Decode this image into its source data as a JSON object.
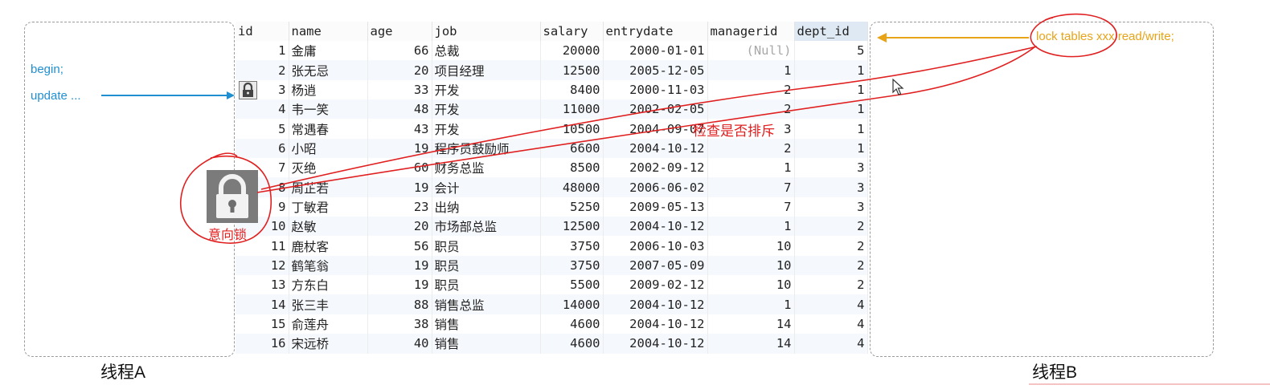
{
  "thread_a": {
    "label": "线程A",
    "lines": [
      "begin;",
      "update ..."
    ]
  },
  "thread_b": {
    "label": "线程B",
    "command": "lock tables xxx read/write;"
  },
  "annotations": {
    "intent_lock": "意向锁",
    "check": "检查是否排斥"
  },
  "colors": {
    "annotation_red": "#e02020",
    "arrow_blue": "#1f8fd1",
    "arrow_orange": "#e8a317"
  },
  "table": {
    "columns": [
      "id",
      "name",
      "age",
      "job",
      "salary",
      "entrydate",
      "managerid",
      "dept_id"
    ],
    "rows": [
      [
        "1",
        "金庸",
        "66",
        "总裁",
        "20000",
        "2000-01-01",
        "(Null)",
        "5"
      ],
      [
        "2",
        "张无忌",
        "20",
        "项目经理",
        "12500",
        "2005-12-05",
        "1",
        "1"
      ],
      [
        "3",
        "杨逍",
        "33",
        "开发",
        "8400",
        "2000-11-03",
        "2",
        "1"
      ],
      [
        "4",
        "韦一笑",
        "48",
        "开发",
        "11000",
        "2002-02-05",
        "2",
        "1"
      ],
      [
        "5",
        "常遇春",
        "43",
        "开发",
        "10500",
        "2004-09-07",
        "3",
        "1"
      ],
      [
        "6",
        "小昭",
        "19",
        "程序员鼓励师",
        "6600",
        "2004-10-12",
        "2",
        "1"
      ],
      [
        "7",
        "灭绝",
        "60",
        "财务总监",
        "8500",
        "2002-09-12",
        "1",
        "3"
      ],
      [
        "8",
        "周芷若",
        "19",
        "会计",
        "48000",
        "2006-06-02",
        "7",
        "3"
      ],
      [
        "9",
        "丁敏君",
        "23",
        "出纳",
        "5250",
        "2009-05-13",
        "7",
        "3"
      ],
      [
        "10",
        "赵敏",
        "20",
        "市场部总监",
        "12500",
        "2004-10-12",
        "1",
        "2"
      ],
      [
        "11",
        "鹿杖客",
        "56",
        "职员",
        "3750",
        "2006-10-03",
        "10",
        "2"
      ],
      [
        "12",
        "鹤笔翁",
        "19",
        "职员",
        "3750",
        "2007-05-09",
        "10",
        "2"
      ],
      [
        "13",
        "方东白",
        "19",
        "职员",
        "5500",
        "2009-02-12",
        "10",
        "2"
      ],
      [
        "14",
        "张三丰",
        "88",
        "销售总监",
        "14000",
        "2004-10-12",
        "1",
        "4"
      ],
      [
        "15",
        "俞莲舟",
        "38",
        "销售",
        "4600",
        "2004-10-12",
        "14",
        "4"
      ],
      [
        "16",
        "宋远桥",
        "40",
        "销售",
        "4600",
        "2004-10-12",
        "14",
        "4"
      ]
    ]
  }
}
